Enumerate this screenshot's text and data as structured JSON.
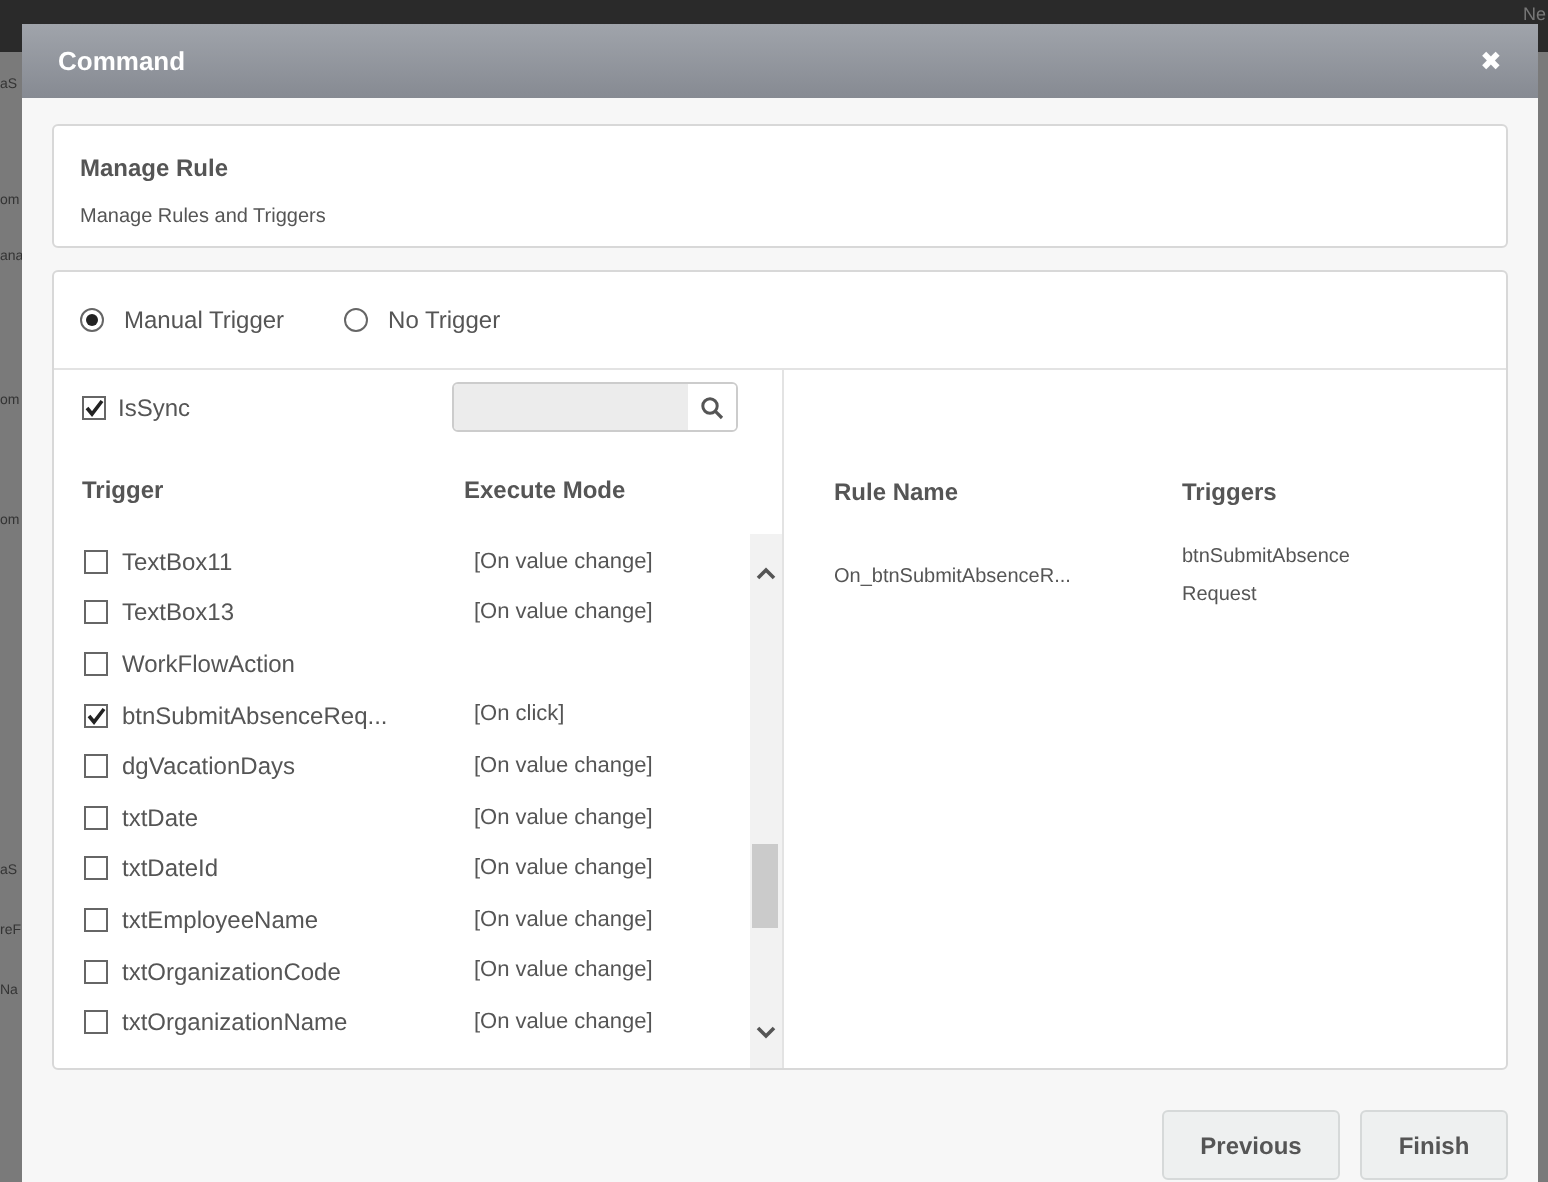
{
  "background_page": {
    "fragments": [
      "aS",
      "om",
      "ana",
      "om",
      "om",
      "aS",
      "reF",
      "Na"
    ],
    "corner_text": "Ne"
  },
  "dialog": {
    "title": "Command",
    "close_icon": "✖"
  },
  "header_card": {
    "title": "Manage Rule",
    "subtitle": "Manage Rules and Triggers"
  },
  "trigger_options": [
    {
      "label": "Manual Trigger",
      "selected": true
    },
    {
      "label": "No Trigger",
      "selected": false
    }
  ],
  "is_sync": {
    "label": "IsSync",
    "checked": true
  },
  "trigger_table": {
    "columns": [
      "Trigger",
      "Execute Mode"
    ],
    "rows": [
      {
        "name": "TextBox11",
        "mode": "[On value change]",
        "checked": false
      },
      {
        "name": "TextBox13",
        "mode": "[On value change]",
        "checked": false
      },
      {
        "name": "WorkFlowAction",
        "checked": false
      },
      {
        "name": "btnSubmitAbsenceReq...",
        "mode": "[On click]",
        "checked": true
      },
      {
        "name": "dgVacationDays",
        "mode": "[On value change]",
        "checked": false
      },
      {
        "name": "txtDate",
        "mode": "[On value change]",
        "checked": false
      },
      {
        "name": "txtDateId",
        "mode": "[On value change]",
        "checked": false
      },
      {
        "name": "txtEmployeeName",
        "mode": "[On value change]",
        "checked": false
      },
      {
        "name": "txtOrganizationCode",
        "mode": "[On value change]",
        "checked": false
      },
      {
        "name": "txtOrganizationName",
        "mode": "[On value change]",
        "checked": false
      }
    ]
  },
  "rules_table": {
    "columns": [
      "Rule Name",
      "Triggers"
    ],
    "rows": [
      {
        "rule_name": "On_btnSubmitAbsenceR...",
        "triggers": "btnSubmitAbsenceRequest"
      }
    ]
  },
  "buttons": [
    "Previous",
    "Finish"
  ]
}
